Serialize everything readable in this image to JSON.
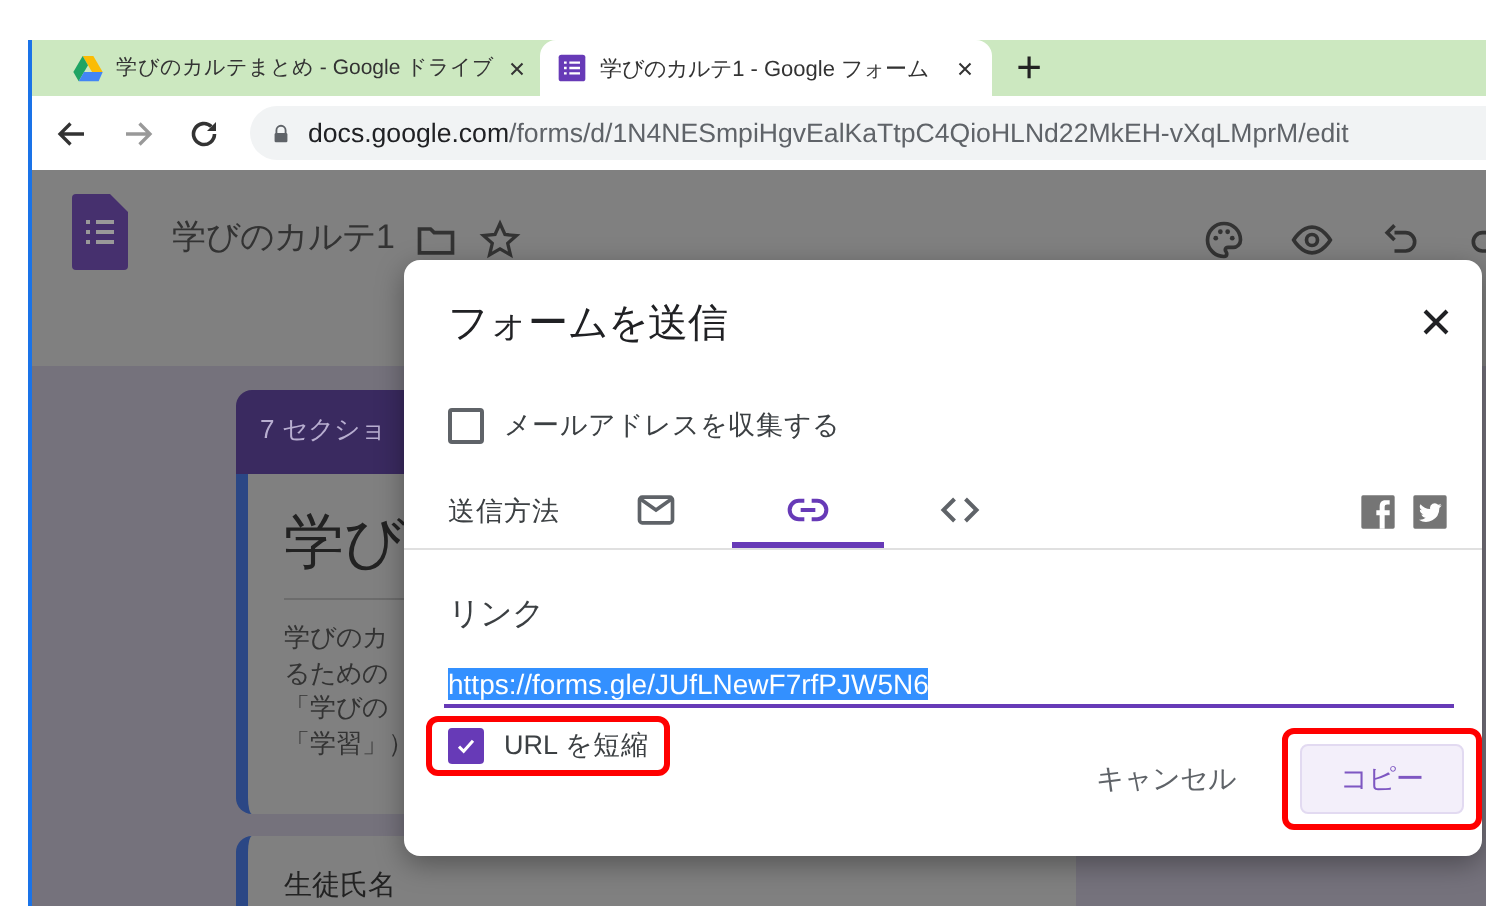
{
  "browser": {
    "tabs": [
      {
        "title": "学びのカルテまとめ - Google ドライブ",
        "kind": "drive",
        "selected": false
      },
      {
        "title": "学びのカルテ1 - Google フォーム",
        "kind": "forms",
        "selected": true
      }
    ],
    "new_tab": "+",
    "url_host": "docs.google.com",
    "url_path": "/forms/d/1N4NESmpiHgvEalKaTtpC4QioHLNd22MkEH-vXqLMprM/edit"
  },
  "form_header": {
    "title": "学びのカルテ1"
  },
  "background_form": {
    "section_badge": "7 セクショ",
    "title": "学び",
    "description": [
      "学びのカ",
      "るための",
      "「学びの",
      "「学習」）"
    ],
    "next_question": "生徒氏名"
  },
  "dialog": {
    "title": "フォームを送信",
    "collect_email": {
      "label": "メールアドレスを収集する",
      "checked": false
    },
    "send_via_label": "送信方法",
    "methods": [
      {
        "kind": "email",
        "selected": false
      },
      {
        "kind": "link",
        "selected": true
      },
      {
        "kind": "embed",
        "selected": false
      }
    ],
    "share": [
      {
        "kind": "facebook"
      },
      {
        "kind": "twitter"
      }
    ],
    "link_label": "リンク",
    "link_value": "https://forms.gle/JUfLNewF7rfPJW5N6",
    "shorten_url": {
      "label": "URL を短縮",
      "checked": true,
      "highlighted": true
    },
    "buttons": [
      {
        "label": "キャンセル",
        "kind": "text",
        "highlighted": false
      },
      {
        "label": "コピー",
        "kind": "filled",
        "highlighted": true
      }
    ]
  }
}
